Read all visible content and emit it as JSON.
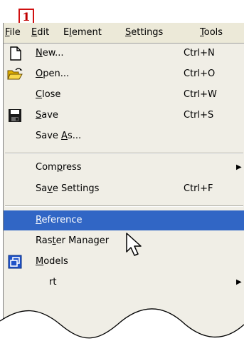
{
  "step_badge": "1",
  "menubar": {
    "items": [
      {
        "label": "File",
        "accel": "F",
        "rest": "ile"
      },
      {
        "label": "Edit",
        "accel": "E",
        "rest": "dit"
      },
      {
        "label": "Element",
        "pre": "E",
        "accel": "l",
        "rest": "ement"
      },
      {
        "label": "Settings",
        "accel": "S",
        "rest": "ettings"
      },
      {
        "label": "Tools",
        "accel": "T",
        "rest": "ools"
      }
    ]
  },
  "menu": {
    "new": {
      "pre": "",
      "accel": "N",
      "rest": "ew...",
      "shortcut": "Ctrl+N",
      "icon": "new-document-icon"
    },
    "open": {
      "pre": "",
      "accel": "O",
      "rest": "pen...",
      "shortcut": "Ctrl+O",
      "icon": "open-folder-icon"
    },
    "close": {
      "pre": "",
      "accel": "C",
      "rest": "lose",
      "shortcut": "Ctrl+W"
    },
    "save": {
      "pre": "",
      "accel": "S",
      "rest": "ave",
      "shortcut": "Ctrl+S",
      "icon": "floppy-disk-icon"
    },
    "save_as": {
      "pre": "Save ",
      "accel": "A",
      "rest": "s..."
    },
    "compress": {
      "pre": "Com",
      "accel": "p",
      "rest": "ress",
      "submenu": "▶"
    },
    "save_settings": {
      "pre": "Sa",
      "accel": "v",
      "rest": "e Settings",
      "shortcut": "Ctrl+F"
    },
    "reference": {
      "pre": "",
      "accel": "R",
      "rest": "eference"
    },
    "raster_manager": {
      "pre": "Ras",
      "accel": "t",
      "rest": "er Manager"
    },
    "models": {
      "pre": "",
      "accel": "M",
      "rest": "odels",
      "icon": "models-icon"
    },
    "partial": {
      "text": "rt",
      "submenu": "▶"
    }
  },
  "colors": {
    "highlight": "#3166c5",
    "menu_bg": "#f0eee6",
    "badge_border": "#d01010"
  }
}
